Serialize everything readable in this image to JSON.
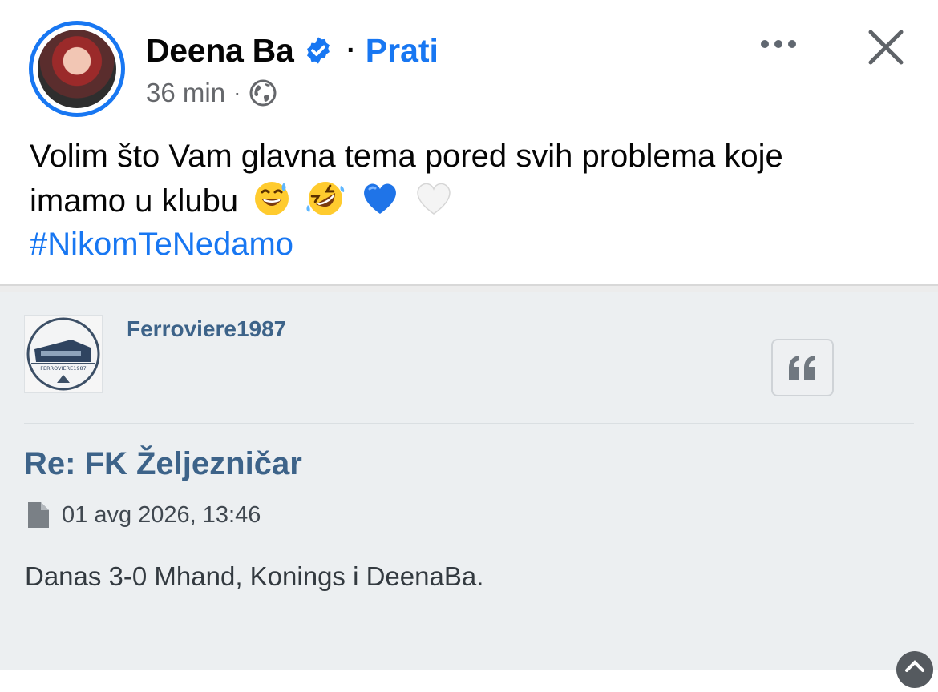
{
  "post": {
    "author": "Deena Ba",
    "separator": "·",
    "follow_label": "Prati",
    "time": "36 min",
    "meta_dot": "·",
    "audience_icon": "globe-icon",
    "text_line1": "Volim što Vam glavna tema pored svih problema koje",
    "text_line2": "imamo u klubu",
    "emojis": [
      "sweat-smile-emoji",
      "rofl-emoji",
      "blue-heart-emoji",
      "white-heart-emoji"
    ],
    "hashtag": "#NikomTeNedamo"
  },
  "forum": {
    "username": "Ferroviere1987",
    "avatar_text": "FERROVIERE1987",
    "title": "Re: FK Željezničar",
    "date": "01 avg 2026, 13:46",
    "body": "Danas 3-0 Mhand, Konings i DeenaBa."
  },
  "colors": {
    "accent": "#1877f2",
    "forum_link": "#3d6389",
    "forum_bg": "#eceff1"
  }
}
